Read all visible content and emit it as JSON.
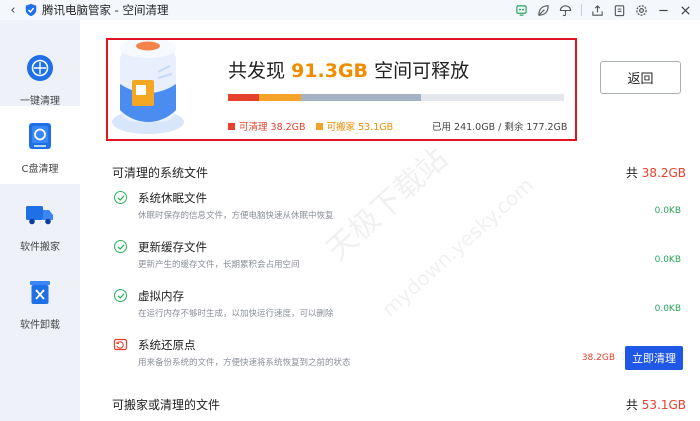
{
  "titlebar": {
    "title": "腾讯电脑管家 - 空间清理"
  },
  "sidebar": {
    "items": [
      {
        "label": "一键清理"
      },
      {
        "label": "C盘清理"
      },
      {
        "label": "软件搬家"
      },
      {
        "label": "软件卸载"
      }
    ]
  },
  "hero": {
    "prefix": "共发现",
    "amount": "91.3GB",
    "suffix": "空间可释放",
    "cleanable_label": "可清理 38.2GB",
    "movable_label": "可搬家 53.1GB",
    "usage": "已用 241.0GB / 剩余 177.2GB",
    "back_label": "返回"
  },
  "bar_segments": [
    {
      "color": "#e5412d",
      "fraction": 0.091
    },
    {
      "color": "#f5a228",
      "fraction": 0.126
    },
    {
      "color": "#a5b2c4",
      "fraction": 0.356
    }
  ],
  "sections": {
    "system": {
      "title": "可清理的系统文件",
      "total_prefix": "共",
      "total": "38.2GB"
    },
    "movable": {
      "title": "可搬家或清理的文件",
      "total_prefix": "共",
      "total": "53.1GB"
    }
  },
  "rows": [
    {
      "name": "系统休眠文件",
      "desc": "休眠时保存的信息文件，方便电脑快速从休眠中恢复",
      "size": "0.0KB"
    },
    {
      "name": "更新缓存文件",
      "desc": "更新产生的缓存文件，长期累积会占用空间",
      "size": "0.0KB"
    },
    {
      "name": "虚拟内存",
      "desc": "在运行内存不够时生成，以加快运行速度，可以删除",
      "size": "0.0KB"
    },
    {
      "name": "系统还原点",
      "desc": "用来备份系统的文件，方便快速将系统恢复到之前的状态",
      "size": "38.2GB",
      "button": "立即清理"
    }
  ],
  "watermark": {
    "line1": "天极下载站",
    "line2": "mydown.yesky.com"
  },
  "colors": {
    "accent": "#1f57e6",
    "clean": "#e5412d",
    "move": "#f5a228",
    "ok": "#28b35a"
  }
}
